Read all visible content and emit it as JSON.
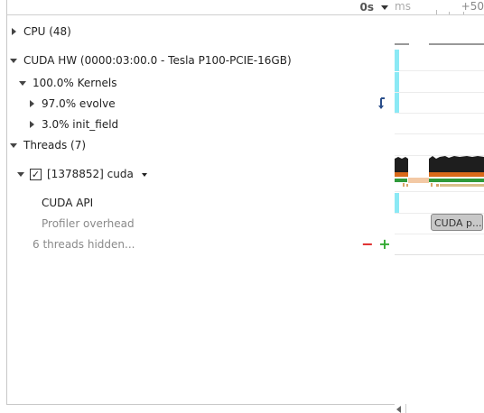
{
  "header": {
    "time_label": "0s"
  },
  "ruler": {
    "unit": "ms",
    "value": "+50"
  },
  "tree": {
    "cpu": {
      "label": "CPU (48)",
      "expanded": false
    },
    "cuda_hw": {
      "label": "CUDA HW (0000:03:00.0 - Tesla P100-PCIE-16GB)",
      "expanded": true
    },
    "kernels": {
      "label": "100.0% Kernels",
      "expanded": true
    },
    "evolve": {
      "label": "97.0% evolve",
      "expanded": false
    },
    "init_field": {
      "label": "3.0% init_field",
      "expanded": false
    },
    "threads": {
      "label": "Threads (7)",
      "expanded": true
    },
    "thread_cuda": {
      "label": "[1378852] cuda",
      "checked": true,
      "check_glyph": "✓"
    },
    "cuda_api": {
      "label": "CUDA API"
    },
    "profiler_overhead": {
      "label": "Profiler overhead"
    },
    "hidden_threads": {
      "label": "6 threads hidden...",
      "minus": "−",
      "plus": "+"
    }
  },
  "timeline": {
    "cuda_badge": "CUDA p..."
  },
  "colors": {
    "cyan_marker": "#8be9f5",
    "thread_dark": "#1e1e1e",
    "thread_orange": "#d96a1a",
    "thread_green": "#2f9a3a",
    "thread_peach": "#f3c9a5",
    "minus": "#dd2222",
    "plus": "#33aa33"
  },
  "icons": {
    "caret_collapsed": "caret-right-icon",
    "caret_expanded": "caret-down-icon",
    "jump": "jump-to-kernel-icon",
    "dropdown": "chevron-down-icon"
  }
}
